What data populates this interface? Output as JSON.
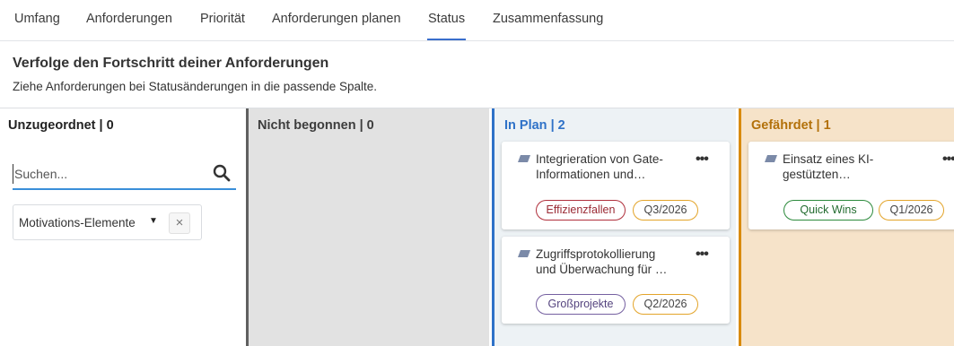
{
  "tabs": [
    {
      "label": "Umfang"
    },
    {
      "label": "Anforderungen"
    },
    {
      "label": "Priorität"
    },
    {
      "label": "Anforderungen planen"
    },
    {
      "label": "Status",
      "active": true
    },
    {
      "label": "Zusammenfassung"
    }
  ],
  "intro": {
    "title": "Verfolge den Fortschritt deiner Anforderungen",
    "subtitle": "Ziehe Anforderungen bei Statusänderungen in die passende Spalte."
  },
  "columns": {
    "unassigned": {
      "title": "Unzugeordnet | 0"
    },
    "not_started": {
      "title": "Nicht begonnen | 0"
    },
    "in_plan": {
      "title": "In Plan | 2"
    },
    "at_risk": {
      "title": "Gefährdet | 1"
    }
  },
  "search": {
    "placeholder": "Suchen...",
    "icon": "search-icon"
  },
  "filter": {
    "label": "Motivations-Elemente",
    "clear": "×"
  },
  "cards": [
    {
      "title_line1": "Integrieration von Gate-",
      "title_line2": "Informationen und…",
      "tag1": "Effizienzfallen",
      "tag2": "Q3/2026",
      "more": "•••"
    },
    {
      "title_line1": "Zugriffsprotokollierung",
      "title_line2": "und Überwachung für …",
      "tag1": "Großprojekte",
      "tag2": "Q2/2026",
      "more": "•••"
    },
    {
      "title_line1": "Einsatz eines KI-",
      "title_line2": "gestützten…",
      "tag1": "Quick Wins",
      "tag2": "Q1/2026",
      "more": "•••"
    }
  ],
  "colors": {
    "accent": "#3a6ecc",
    "in_plan": "#2f72c8",
    "at_risk": "#d98b0e",
    "not_started": "#606060"
  }
}
